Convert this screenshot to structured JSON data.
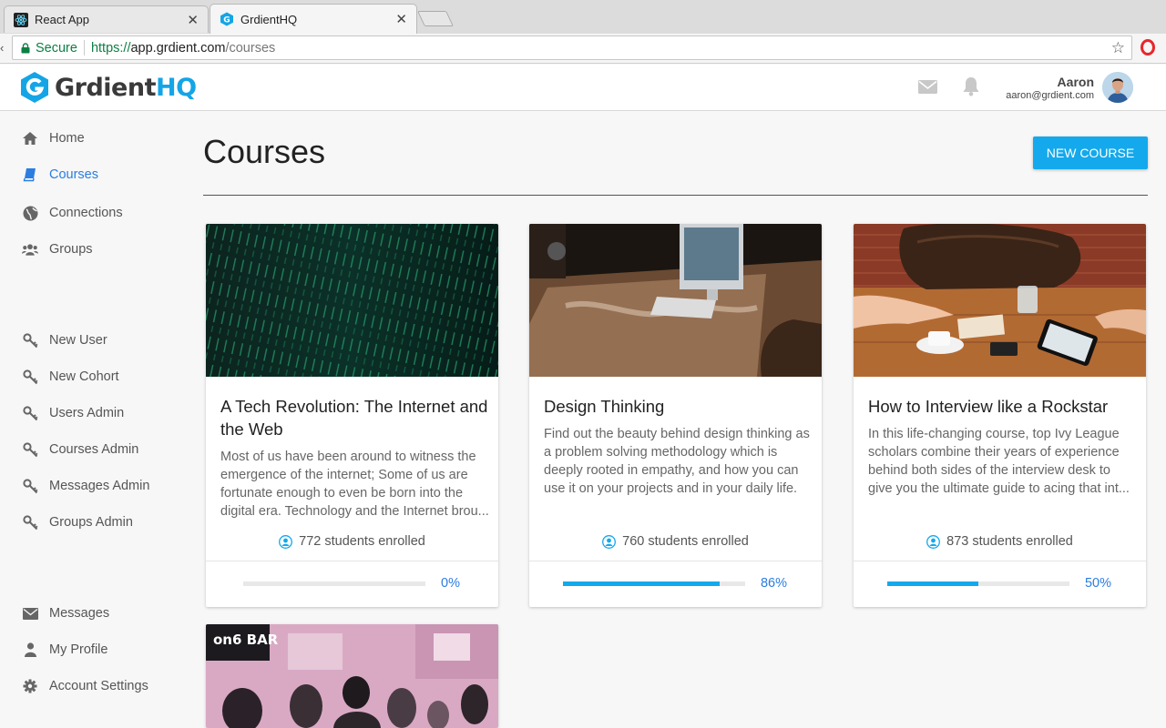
{
  "browser": {
    "tabs": [
      {
        "label": "React App"
      },
      {
        "label": "GrdientHQ"
      }
    ],
    "secure_label": "Secure",
    "url_scheme": "https://",
    "url_host": "app.grdient.com",
    "url_path": "/courses"
  },
  "header": {
    "logo_part1": "Grdient",
    "logo_part2": "HQ",
    "user_name": "Aaron",
    "user_email": "aaron@grdient.com",
    "icons": [
      "mail-icon",
      "bell-icon"
    ]
  },
  "sidebar": {
    "primary": [
      {
        "label": "Home",
        "icon": "home-icon"
      },
      {
        "label": "Courses",
        "icon": "book-icon",
        "active": true
      },
      {
        "label": "Connections",
        "icon": "globe-icon"
      },
      {
        "label": "Groups",
        "icon": "users-icon"
      }
    ],
    "admin": [
      {
        "label": "New User",
        "icon": "key-icon"
      },
      {
        "label": "New Cohort",
        "icon": "key-icon"
      },
      {
        "label": "Users Admin",
        "icon": "key-icon"
      },
      {
        "label": "Courses Admin",
        "icon": "key-icon"
      },
      {
        "label": "Messages Admin",
        "icon": "key-icon"
      },
      {
        "label": "Groups Admin",
        "icon": "key-icon"
      }
    ],
    "secondary": [
      {
        "label": "Messages",
        "icon": "envelope-icon"
      },
      {
        "label": "My Profile",
        "icon": "person-icon"
      },
      {
        "label": "Account Settings",
        "icon": "gear-icon"
      }
    ]
  },
  "main": {
    "title": "Courses",
    "new_course_label": "NEW COURSE",
    "courses": [
      {
        "title": "A Tech Revolution: The Internet and the Web",
        "description": "Most of us have been around to witness the emergence of the internet; Some of us are fortunate enough to even be born into the digital era. Technology and the Internet brou...",
        "enrolled": "772 students enrolled",
        "progress_label": "0%",
        "progress": 0
      },
      {
        "title": "Design Thinking",
        "description": "Find out the beauty behind design thinking as a problem solving methodology which is deeply rooted in empathy, and how you can use it on your projects and in your daily life.",
        "enrolled": "760 students enrolled",
        "progress_label": "86%",
        "progress": 86
      },
      {
        "title": "How to Interview like a Rockstar",
        "description": "In this life-changing course, top Ivy League scholars combine their years of experience behind both sides of the interview desk to give you the ultimate guide to acing that int...",
        "enrolled": "873 students enrolled",
        "progress_label": "50%",
        "progress": 50
      }
    ],
    "partial_card_sign": "on6 BAR"
  },
  "colors": {
    "accent": "#14a9ec",
    "link_blue": "#2a7de1"
  }
}
